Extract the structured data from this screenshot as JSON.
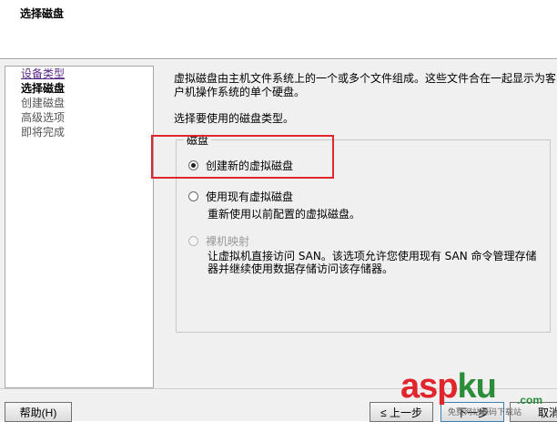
{
  "header": {
    "title": "选择磁盘"
  },
  "steps": [
    {
      "label": "设备类型",
      "state": "link"
    },
    {
      "label": "选择磁盘",
      "state": "current"
    },
    {
      "label": "创建磁盘",
      "state": "pending"
    },
    {
      "label": "高级选项",
      "state": "pending"
    },
    {
      "label": "即将完成",
      "state": "pending"
    }
  ],
  "content": {
    "description_line1": "虚拟磁盘由主机文件系统上的一个或多个文件组成。这些文件合在一起显示为客",
    "description_line2": "户机操作系统的单个硬盘。",
    "prompt": "选择要使用的磁盘类型。",
    "group_label": "磁盘",
    "options": [
      {
        "label": "创建新的虚拟磁盘",
        "checked": true,
        "disabled": false,
        "description": []
      },
      {
        "label": "使用现有虚拟磁盘",
        "checked": false,
        "disabled": false,
        "description": [
          "重新使用以前配置的虚拟磁盘。"
        ]
      },
      {
        "label": "裸机映射",
        "checked": false,
        "disabled": true,
        "description": [
          "让虚拟机直接访问 SAN。该选项允许您使用现有 SAN 命令管理存储",
          "器并继续使用数据存储访问该存储器。"
        ]
      }
    ]
  },
  "footer": {
    "help_label": "帮助(H)",
    "back_label": "≤ 上一步",
    "next_label": "下一步",
    "cancel_label": "取消"
  },
  "watermark": {
    "main_a": "asp",
    "main_k": "ku",
    "suffix": ".com",
    "sub": "免费网站源码下载站"
  },
  "colors": {
    "highlight": "#e0262c",
    "link": "#5a2a8a",
    "watermark_red": "#e0262c",
    "watermark_green": "#2b8c3a"
  }
}
